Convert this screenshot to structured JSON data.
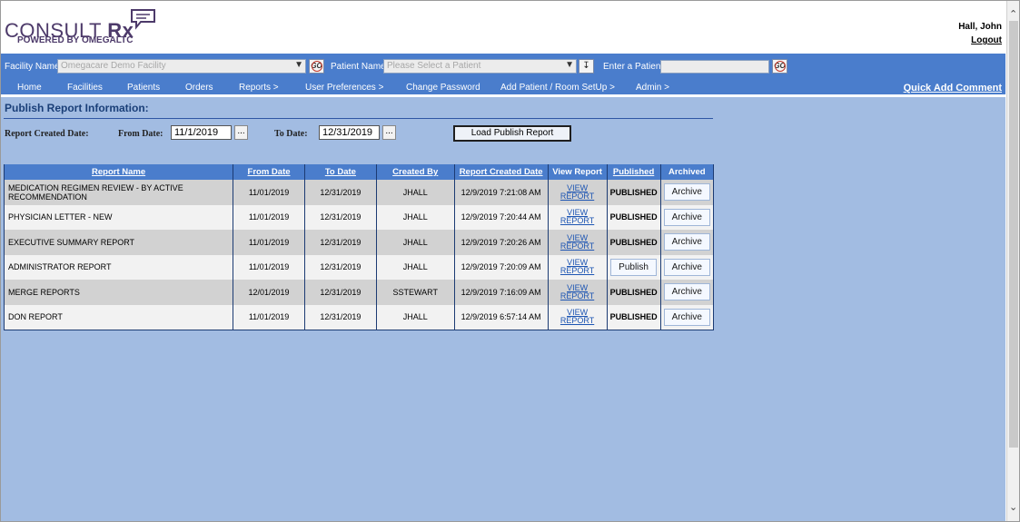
{
  "logo": {
    "consult": "CONSULT",
    "rx": "Rx",
    "powered": "POWERED BY",
    "brand": "OMEGALTC"
  },
  "user": {
    "name": "Hall, John",
    "logout": "Logout"
  },
  "filters": {
    "facility_label": "Facility Name:",
    "facility_value": "Omegacare Demo Facility",
    "patient_label": "Patient Name:",
    "patient_placeholder": "Please Select a Patient",
    "enter_patient_label": "Enter a Patient:",
    "go_label": "GO"
  },
  "nav": {
    "items": [
      "Home",
      "Facilities",
      "Patients",
      "Orders",
      "Reports >",
      "User Preferences >",
      "Change Password",
      "Add Patient / Room SetUp >",
      "Admin >"
    ],
    "quick_add": "Quick Add Comment"
  },
  "section_title": "Publish Report Information:",
  "form": {
    "created_label": "Report Created Date:",
    "from_label": "From Date:",
    "from_value": "11/1/2019",
    "to_label": "To Date:",
    "to_value": "12/31/2019",
    "dots": "...",
    "load_button": "Load Publish Report"
  },
  "table": {
    "headers": [
      "Report Name",
      "From Date",
      "To Date",
      "Created By",
      "Report Created Date",
      "View Report",
      "Published",
      "Archived"
    ],
    "rows": [
      {
        "name": "MEDICATION REGIMEN REVIEW - BY ACTIVE RECOMMENDATION",
        "from": "11/01/2019",
        "to": "12/31/2019",
        "by": "JHALL",
        "created": "12/9/2019 7:21:08 AM",
        "view": "VIEW REPORT",
        "published": "PUBLISHED",
        "archived": "Archive"
      },
      {
        "name": "PHYSICIAN LETTER - NEW",
        "from": "11/01/2019",
        "to": "12/31/2019",
        "by": "JHALL",
        "created": "12/9/2019 7:20:44 AM",
        "view": "VIEW REPORT",
        "published": "PUBLISHED",
        "archived": "Archive"
      },
      {
        "name": "EXECUTIVE SUMMARY REPORT",
        "from": "11/01/2019",
        "to": "12/31/2019",
        "by": "JHALL",
        "created": "12/9/2019 7:20:26 AM",
        "view": "VIEW REPORT",
        "published": "PUBLISHED",
        "archived": "Archive"
      },
      {
        "name": "ADMINISTRATOR REPORT",
        "from": "11/01/2019",
        "to": "12/31/2019",
        "by": "JHALL",
        "created": "12/9/2019 7:20:09 AM",
        "view": "VIEW REPORT",
        "published": "Publish",
        "archived": "Archive"
      },
      {
        "name": "MERGE REPORTS",
        "from": "12/01/2019",
        "to": "12/31/2019",
        "by": "SSTEWART",
        "created": "12/9/2019 7:16:09 AM",
        "view": "VIEW REPORT",
        "published": "PUBLISHED",
        "archived": "Archive"
      },
      {
        "name": "DON REPORT",
        "from": "11/01/2019",
        "to": "12/31/2019",
        "by": "JHALL",
        "created": "12/9/2019 6:57:14 AM",
        "view": "VIEW REPORT",
        "published": "PUBLISHED",
        "archived": "Archive"
      }
    ]
  },
  "colors": {
    "nav_bg": "#4a7dcc",
    "page_bg": "#a2bce2",
    "title": "#1a3f78",
    "row_odd": "#d2d2d2",
    "row_even": "#f2f2f2"
  },
  "icons": {
    "go": "go-icon",
    "select_arrow": "chevron-down-icon",
    "patient_search": "patient-lookup-icon"
  }
}
